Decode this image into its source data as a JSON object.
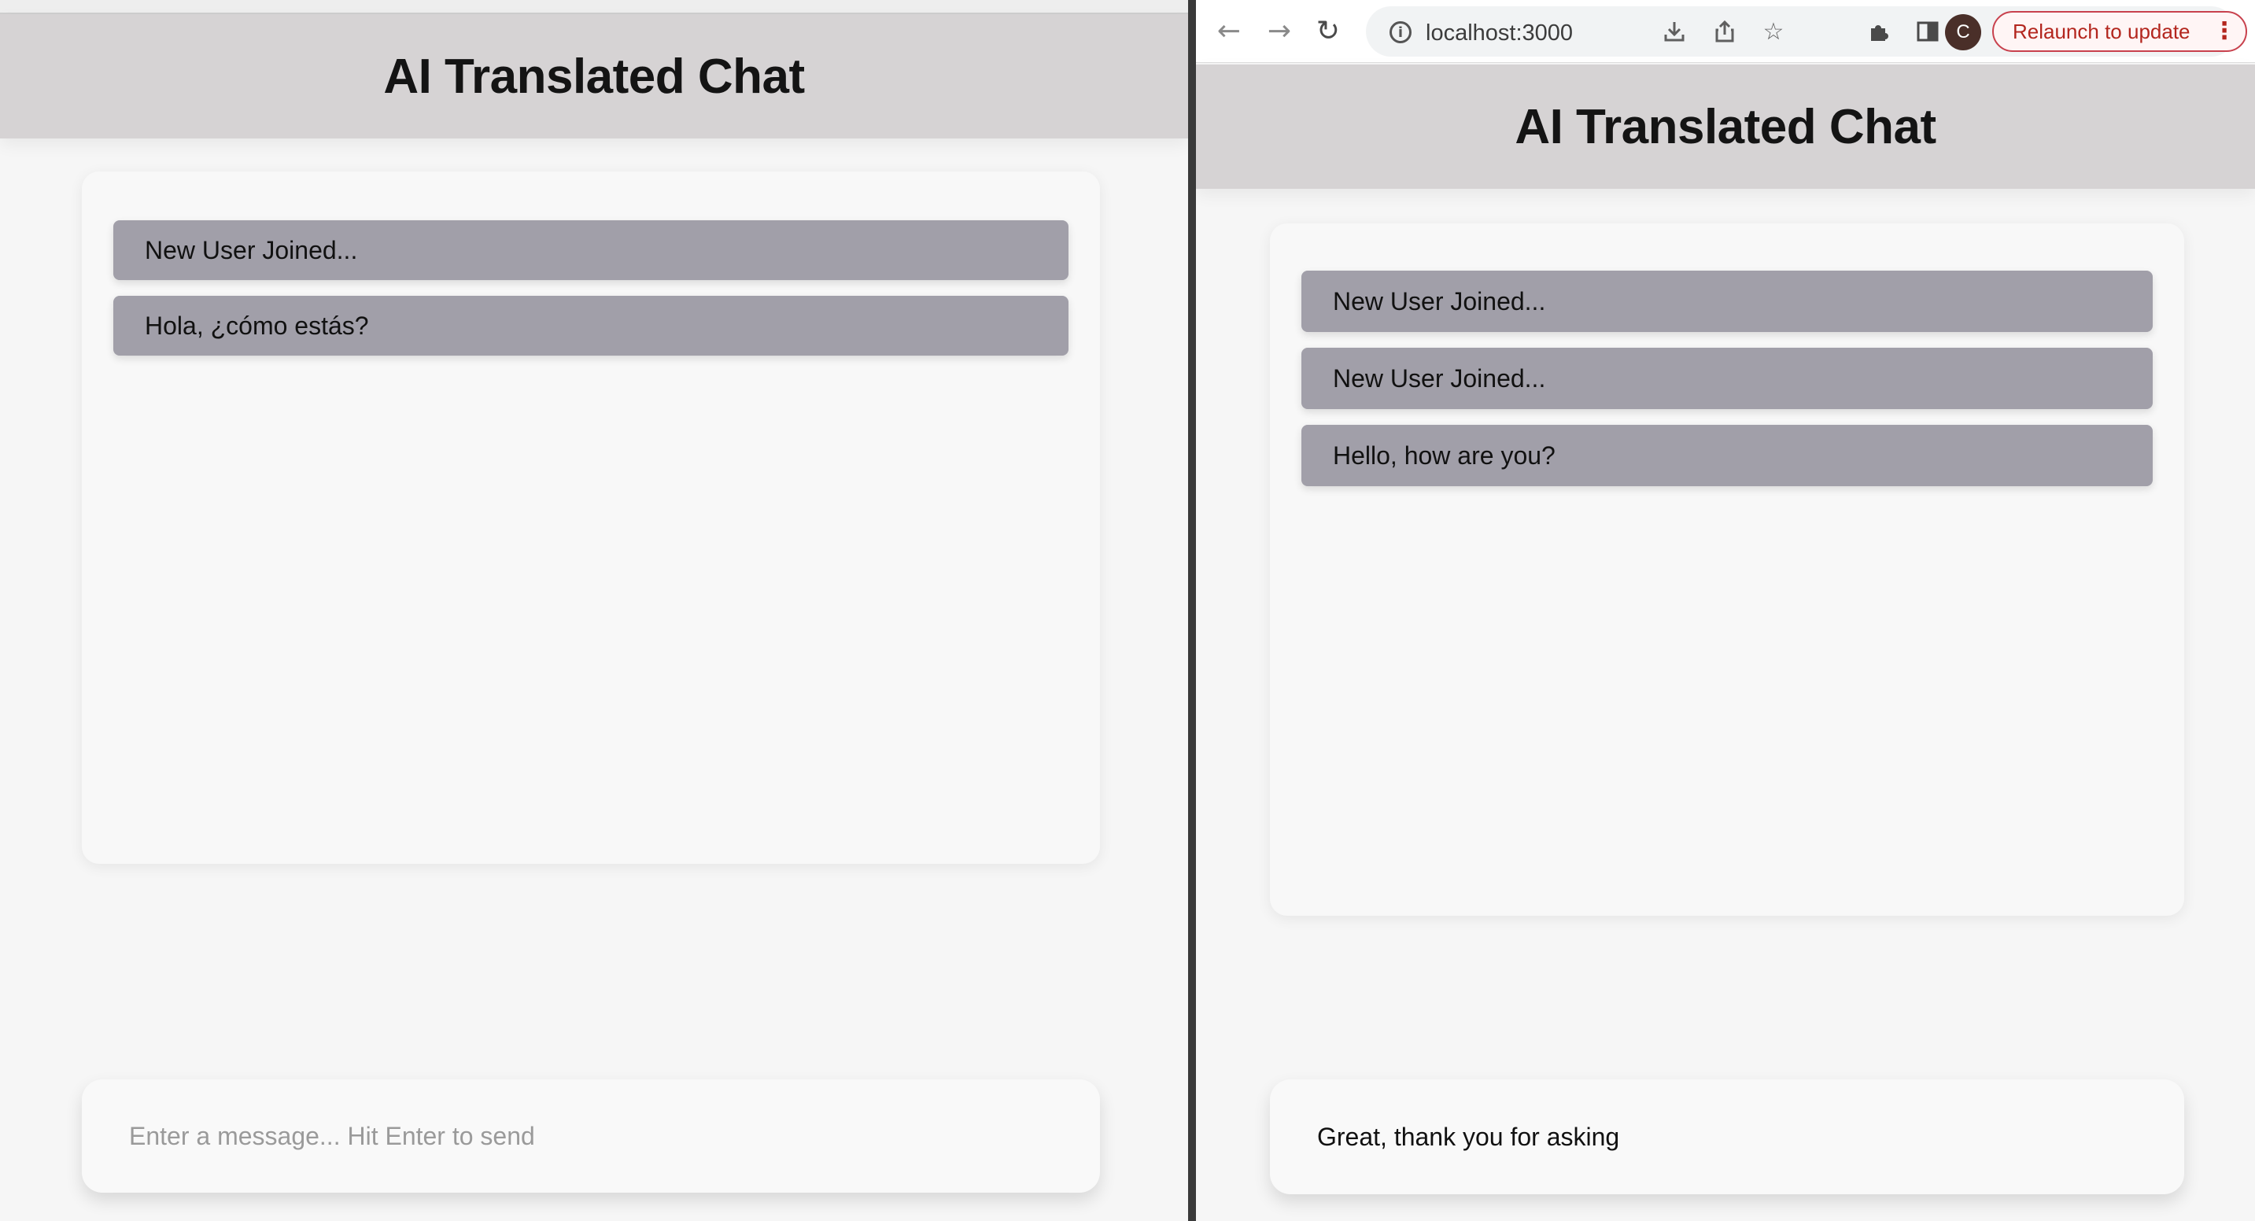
{
  "left_window": {
    "app_title": "AI Translated Chat",
    "messages": [
      "New User Joined...",
      "Hola, ¿cómo estás?"
    ],
    "input": {
      "value": "",
      "placeholder": "Enter a message... Hit Enter to send"
    }
  },
  "right_window": {
    "browser": {
      "back_icon": "back-arrow-icon",
      "forward_icon": "forward-arrow-icon",
      "reload_icon": "reload-icon",
      "url": "localhost:3000",
      "profile_initial": "C",
      "relaunch_label": "Relaunch to update"
    },
    "app_title": "AI Translated Chat",
    "messages": [
      "New User Joined...",
      "New User Joined...",
      "Hello, how are you?"
    ],
    "input": {
      "value": "Great, thank you for asking",
      "placeholder": ""
    }
  },
  "colors": {
    "header_bg": "#d6d3d4",
    "message_bg": "#a19fa9",
    "page_bg": "#f6f6f6",
    "relaunch_accent": "#b3261e"
  }
}
